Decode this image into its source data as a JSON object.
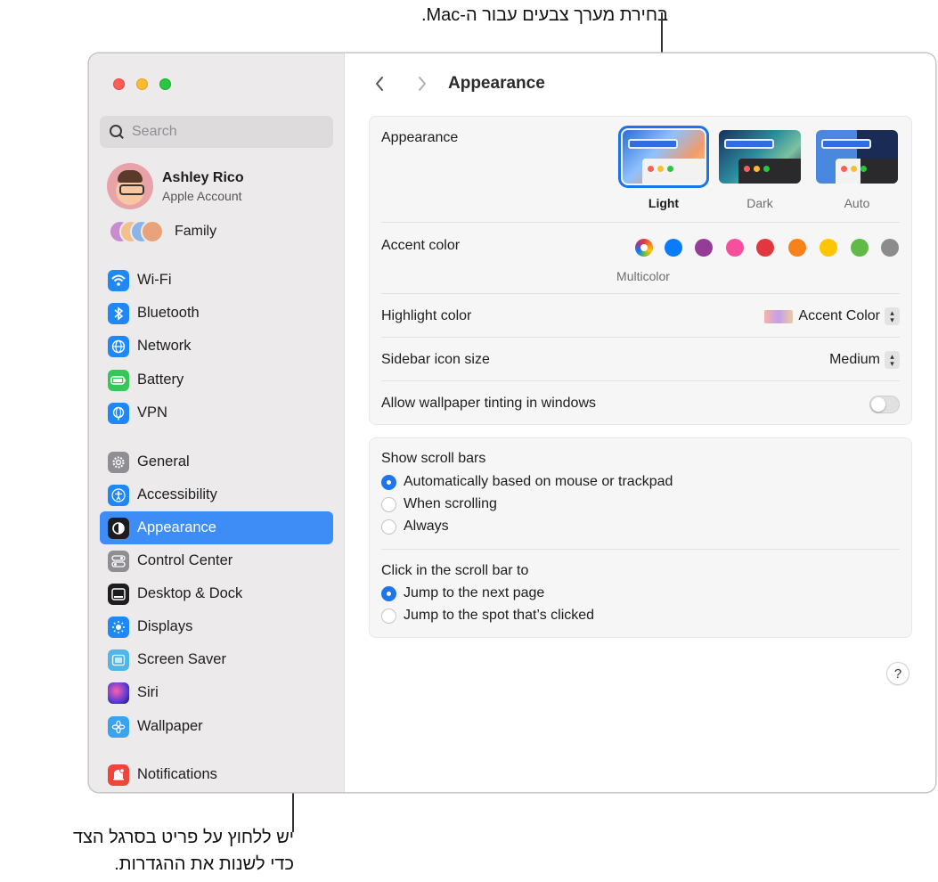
{
  "callouts": {
    "top": "בחירת מערך צבעים עבור ה-Mac.",
    "bottom_line1": "יש ללחוץ על פריט בסרגל הצד",
    "bottom_line2": "כדי לשנות את ההגדרות."
  },
  "sidebar": {
    "search_placeholder": "Search",
    "account": {
      "name": "Ashley Rico",
      "subtitle": "Apple Account"
    },
    "family_label": "Family",
    "items": [
      {
        "label": "Wi-Fi",
        "icon": "wifi-icon",
        "color": "#1e88f5"
      },
      {
        "label": "Bluetooth",
        "icon": "bluetooth-icon",
        "color": "#1e88f5"
      },
      {
        "label": "Network",
        "icon": "globe-icon",
        "color": "#1e88f5"
      },
      {
        "label": "Battery",
        "icon": "battery-icon",
        "color": "#34c759"
      },
      {
        "label": "VPN",
        "icon": "globe-vpn-icon",
        "color": "#1e88f5"
      },
      {
        "label": "General",
        "icon": "gear-icon",
        "color": "#8e8e93"
      },
      {
        "label": "Accessibility",
        "icon": "accessibility-icon",
        "color": "#1e88f5"
      },
      {
        "label": "Appearance",
        "icon": "appearance-icon",
        "color": "#1d1d1f"
      },
      {
        "label": "Control Center",
        "icon": "control-center-icon",
        "color": "#8e8e93"
      },
      {
        "label": "Desktop & Dock",
        "icon": "dock-icon",
        "color": "#1d1d1f"
      },
      {
        "label": "Displays",
        "icon": "sun-icon",
        "color": "#1e88f5"
      },
      {
        "label": "Screen Saver",
        "icon": "screen-saver-icon",
        "color": "#4fb6e8"
      },
      {
        "label": "Siri",
        "icon": "siri-icon",
        "color": "#5a3bd6"
      },
      {
        "label": "Wallpaper",
        "icon": "flower-icon",
        "color": "#3aa3f0"
      },
      {
        "label": "Notifications",
        "icon": "bell-icon",
        "color": "#f0453a"
      }
    ],
    "selected": "Appearance"
  },
  "main": {
    "title": "Appearance",
    "appearance": {
      "label": "Appearance",
      "options": [
        "Light",
        "Dark",
        "Auto"
      ],
      "selected": "Light"
    },
    "accent": {
      "label": "Accent color",
      "selected_name": "Multicolor",
      "colors": [
        "multicolor",
        "#0a7aff",
        "#953d96",
        "#f74f9e",
        "#e0383e",
        "#f7821b",
        "#ffc600",
        "#62ba46",
        "#8c8c8c"
      ]
    },
    "highlight": {
      "label": "Highlight color",
      "value": "Accent Color"
    },
    "sidebar_icon_size": {
      "label": "Sidebar icon size",
      "value": "Medium"
    },
    "wallpaper_tinting": {
      "label": "Allow wallpaper tinting in windows",
      "on": false
    },
    "scroll_bars": {
      "label": "Show scroll bars",
      "options": [
        "Automatically based on mouse or trackpad",
        "When scrolling",
        "Always"
      ],
      "selected": 0
    },
    "click_scroll": {
      "label": "Click in the scroll bar to",
      "options": [
        "Jump to the next page",
        "Jump to the spot that’s clicked"
      ],
      "selected": 0
    },
    "help_label": "?"
  },
  "nav": {
    "back": "‹",
    "forward": "›"
  }
}
